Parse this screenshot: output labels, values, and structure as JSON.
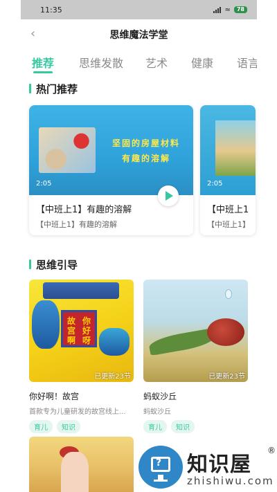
{
  "status": {
    "time": "11:35",
    "battery": "78"
  },
  "header": {
    "title": "思维魔法学堂"
  },
  "tabs": [
    {
      "label": "推荐"
    },
    {
      "label": "思维发散"
    },
    {
      "label": "艺术"
    },
    {
      "label": "健康"
    },
    {
      "label": "语言"
    }
  ],
  "hot": {
    "heading": "热门推荐",
    "cards": [
      {
        "thumb_text_line1": "坚固的房屋材料",
        "thumb_text_line2": "有趣的溶解",
        "duration": "2:05",
        "name": "【中班上1】有趣的溶解",
        "subtitle": "【中班上1】有趣的溶解"
      },
      {
        "duration": "2:05",
        "name": "【中班上1",
        "subtitle": "【中班上1】"
      }
    ]
  },
  "guide": {
    "heading": "思维引导",
    "cards": [
      {
        "sign_chars": [
          "故",
          "你",
          "宫",
          "好",
          "啊",
          "呀"
        ],
        "badge": "已更新23节",
        "name": "你好啊！故宫",
        "subtitle": "首款专为儿童研发的故宫线上...",
        "tags": [
          "育儿",
          "知识"
        ]
      },
      {
        "badge": "已更新23节",
        "name": "蚂蚁沙丘",
        "subtitle": "蚂蚁沙丘",
        "tags": [
          "育儿",
          "知识"
        ]
      }
    ]
  },
  "watermark": {
    "title": "知识屋",
    "reg": "®",
    "url": "zhishiwu.com"
  },
  "colors": {
    "accent": "#36c9a0",
    "status_bar": "#c9c9c9"
  }
}
